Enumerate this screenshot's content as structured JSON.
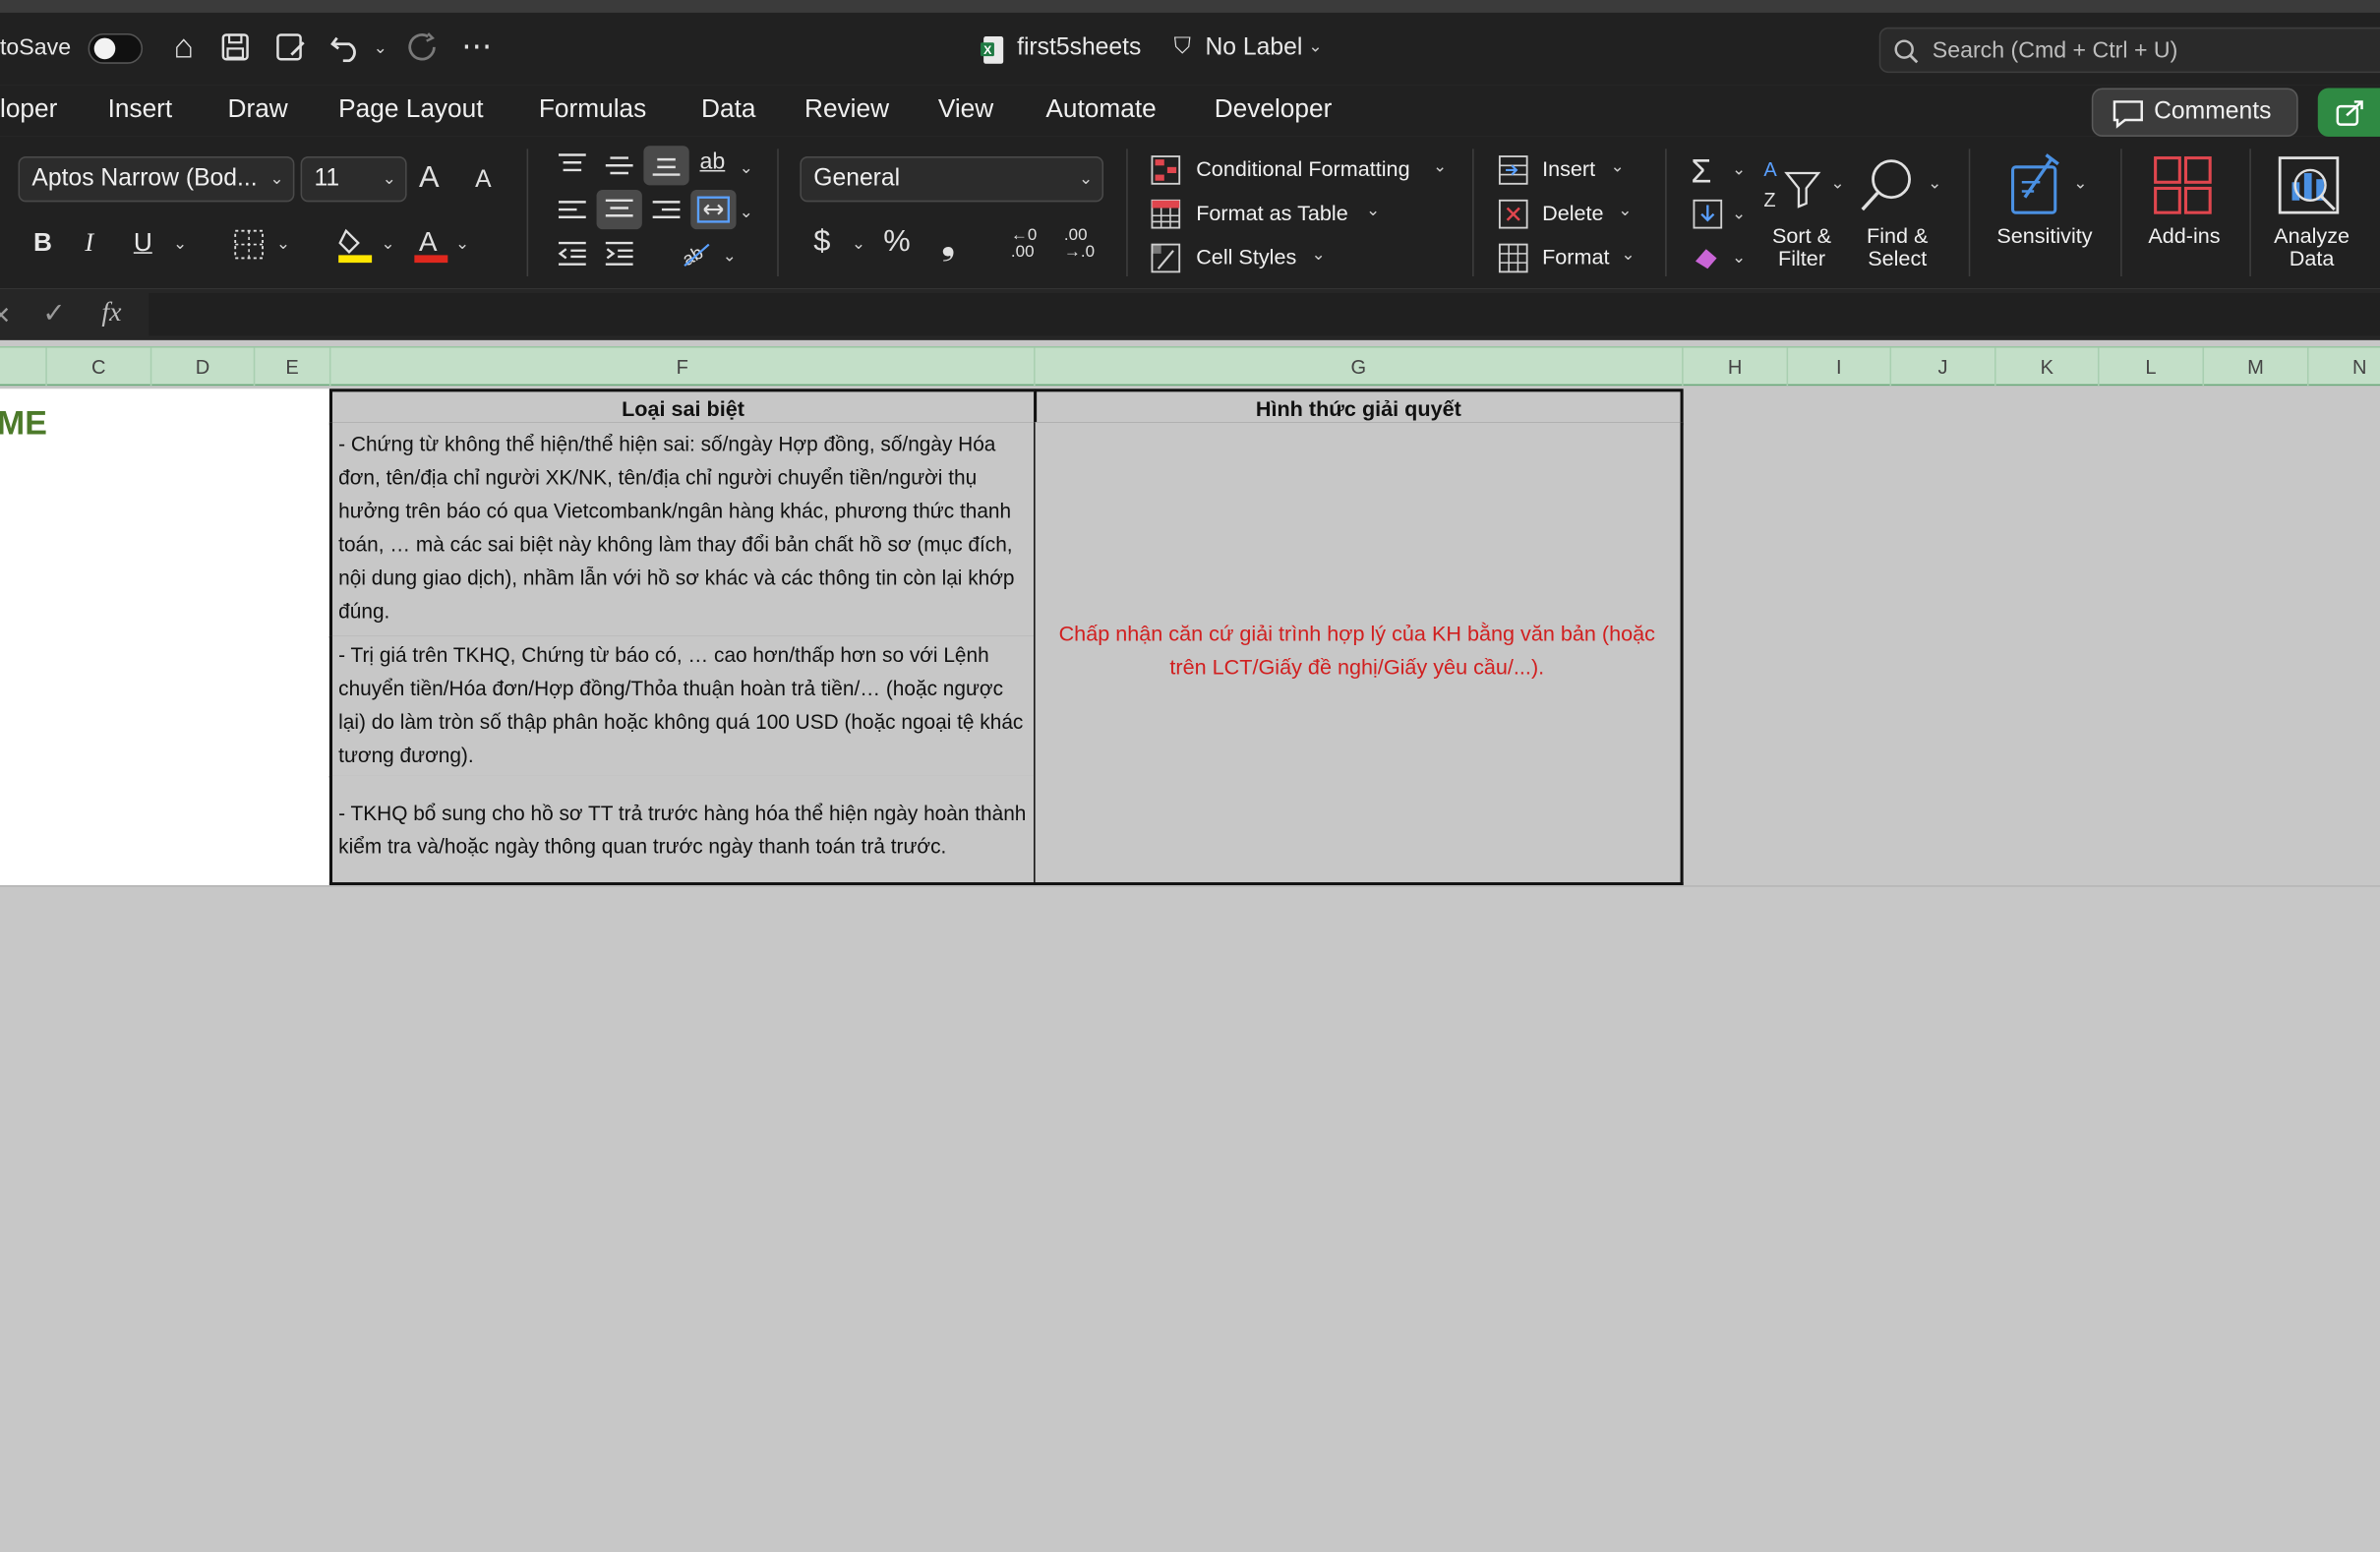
{
  "titlebar": {
    "autosave_label": "toSave",
    "file_name": "first5sheets",
    "label_status": "No Label",
    "search_placeholder": "Search (Cmd + Ctrl + U)"
  },
  "tabs": [
    "loper",
    "Insert",
    "Draw",
    "Page Layout",
    "Formulas",
    "Data",
    "Review",
    "View",
    "Automate",
    "Developer"
  ],
  "comments_label": "Comments",
  "ribbon": {
    "font_name": "Aptos Narrow (Bod...",
    "font_size": "11",
    "number_format": "General",
    "conditional_formatting": "Conditional Formatting",
    "format_as_table": "Format as Table",
    "cell_styles": "Cell Styles",
    "insert": "Insert",
    "delete": "Delete",
    "format": "Format",
    "sort_filter_1": "Sort &",
    "sort_filter_2": "Filter",
    "find_select_1": "Find &",
    "find_select_2": "Select",
    "sensitivity": "Sensitivity",
    "addins": "Add-ins",
    "analyze_1": "Analyze",
    "analyze_2": "Data",
    "bold": "B",
    "italic": "I",
    "underline": "U",
    "currency": "$",
    "percent": "%",
    "comma": "❟",
    "grow_font": "A",
    "shrink_font": "A",
    "dec_inc_1": "←0",
    "dec_inc_2": ".00",
    "dec_dec_1": ".00",
    "dec_dec_2": "→.0"
  },
  "formula_bar": {
    "fx": "fx"
  },
  "columns": [
    "C",
    "D",
    "E",
    "F",
    "G",
    "H",
    "I",
    "J",
    "K",
    "L",
    "M",
    "N"
  ],
  "sheet": {
    "partial_title": "ME",
    "header_f": "Loại sai biệt",
    "header_g": "Hình thức giải quyết",
    "row1": "-    Chứng từ không thể hiện/thể hiện sai: số/ngày Hợp đồng, số/ngày Hóa đơn, tên/địa chỉ người XK/NK, tên/địa chỉ người chuyển tiền/người thụ hưởng trên báo có qua Vietcombank/ngân hàng khác, phương thức thanh toán, … mà các sai biệt này không làm thay đổi bản chất hồ sơ (mục đích, nội dung giao dịch), nhầm lẫn với hồ sơ khác và các thông tin còn lại khớp đúng.",
    "row2": "-    Trị giá trên TKHQ, Chứng từ báo có, … cao hơn/thấp hơn so với Lệnh chuyển tiền/Hóa đơn/Hợp đồng/Thỏa thuận hoàn trả tiền/… (hoặc ngược lại) do làm tròn số thập phân hoặc không quá 100 USD (hoặc ngoại tệ khác tương đương).",
    "row3": "-    TKHQ bổ sung cho hồ sơ TT trả trước hàng hóa thể hiện ngày hoàn thành kiểm tra và/hoặc ngày thông quan trước ngày thanh toán trả trước.",
    "resolution": "Chấp nhận căn cứ giải trình hợp lý của KH bằng văn bản (hoặc trên LCT/Giấy đề nghị/Giấy yêu cầu/...)."
  },
  "colors": {
    "accent_green": "#2f8a43",
    "header_green": "#c3dfc8",
    "resolution_red": "#d11f1f",
    "title_green": "#4c7a2a"
  }
}
